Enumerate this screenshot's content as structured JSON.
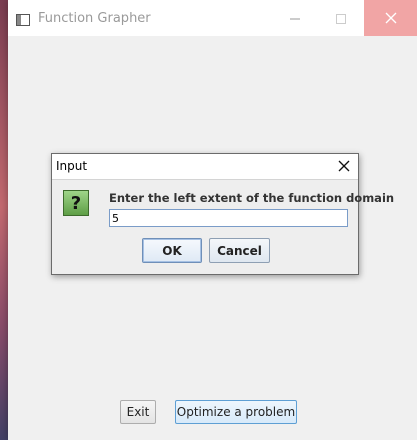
{
  "window": {
    "title": "Function Grapher",
    "icons": {
      "app": "app-window-icon",
      "minimize": "minimize-icon",
      "maximize": "maximize-icon",
      "close": "close-icon"
    }
  },
  "main": {
    "exit_label": "Exit",
    "optimize_label": "Optimize a problem"
  },
  "dialog": {
    "title": "Input",
    "prompt": "Enter the left extent of the function domain",
    "input_value": "5",
    "ok_label": "OK",
    "cancel_label": "Cancel",
    "icon": "question-icon",
    "icon_glyph": "?"
  },
  "colors": {
    "close_hover": "#f1a5a5",
    "question_icon_green": "#5e9e46",
    "focus_blue": "#5e9fd4"
  }
}
